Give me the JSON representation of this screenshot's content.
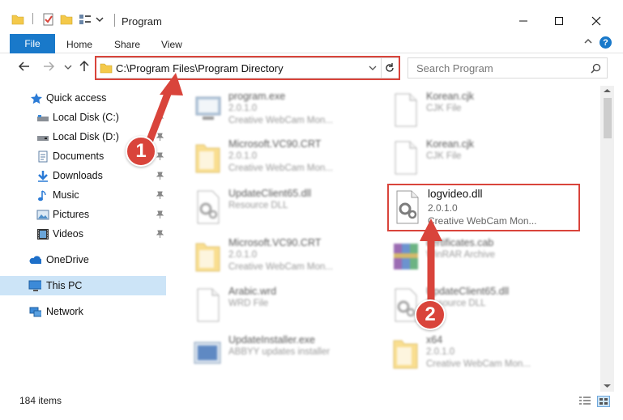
{
  "window": {
    "title": "Program",
    "minimize_icon": "minimize-icon",
    "maximize_icon": "maximize-icon",
    "close_icon": "close-icon"
  },
  "ribbon": {
    "tabs": [
      "File",
      "Home",
      "Share",
      "View"
    ],
    "accent": "#1979ca",
    "help_label": "?"
  },
  "address": {
    "path": "C:\\Program Files\\Program Directory",
    "search_placeholder": "Search Program"
  },
  "sidebar": {
    "items": [
      {
        "label": "Quick access",
        "icon": "star-icon"
      },
      {
        "label": "Local Disk (C:)",
        "icon": "drive-icon"
      },
      {
        "label": "Local Disk (D:)",
        "icon": "drive-icon"
      },
      {
        "label": "Documents",
        "icon": "documents-icon"
      },
      {
        "label": "Downloads",
        "icon": "downloads-icon"
      },
      {
        "label": "Music",
        "icon": "music-icon"
      },
      {
        "label": "Pictures",
        "icon": "pictures-icon"
      },
      {
        "label": "Videos",
        "icon": "videos-icon"
      },
      {
        "label": "OneDrive",
        "icon": "cloud-icon"
      },
      {
        "label": "This PC",
        "icon": "computer-icon"
      },
      {
        "label": "Network",
        "icon": "network-icon"
      }
    ]
  },
  "files": [
    {
      "name": "program.exe",
      "line2": "2.0.1.0",
      "line3": "Creative WebCam Mon...",
      "icon": "exe-icon"
    },
    {
      "name": "Korean.cjk",
      "line2": "CJK File",
      "line3": "",
      "icon": "file-icon"
    },
    {
      "name": "Microsoft.VC90.CRT",
      "line2": "2.0.1.0",
      "line3": "Creative WebCam Mon...",
      "icon": "folder-icon"
    },
    {
      "name": "Korean.cjk",
      "line2": "CJK File",
      "line3": "",
      "icon": "file-icon"
    },
    {
      "name": "UpdateClient65.dll",
      "line2": "Resource DLL",
      "line3": "",
      "icon": "dll-icon"
    },
    {
      "name": "logvideo.dll",
      "line2": "2.0.1.0",
      "line3": "Creative WebCam Mon...",
      "icon": "dll-icon"
    },
    {
      "name": "Microsoft.VC90.CRT",
      "line2": "2.0.1.0",
      "line3": "Creative WebCam Mon...",
      "icon": "folder-icon"
    },
    {
      "name": "certificates.cab",
      "line2": "WinRAR Archive",
      "line3": "",
      "icon": "archive-icon"
    },
    {
      "name": "Arabic.wrd",
      "line2": "WRD File",
      "line3": "",
      "icon": "file-icon"
    },
    {
      "name": "UpdateClient65.dll",
      "line2": "Resource DLL",
      "line3": "",
      "icon": "dll-icon"
    },
    {
      "name": "UpdateInstaller.exe",
      "line2": "ABBYY updates installer",
      "line3": "",
      "icon": "installer-icon"
    },
    {
      "name": "x64",
      "line2": "2.0.1.0",
      "line3": "Creative WebCam Mon...",
      "icon": "folder-icon"
    }
  ],
  "status": {
    "item_count": "184 items"
  },
  "annotations": {
    "step1": "1",
    "step2": "2",
    "color": "#d9443b"
  }
}
